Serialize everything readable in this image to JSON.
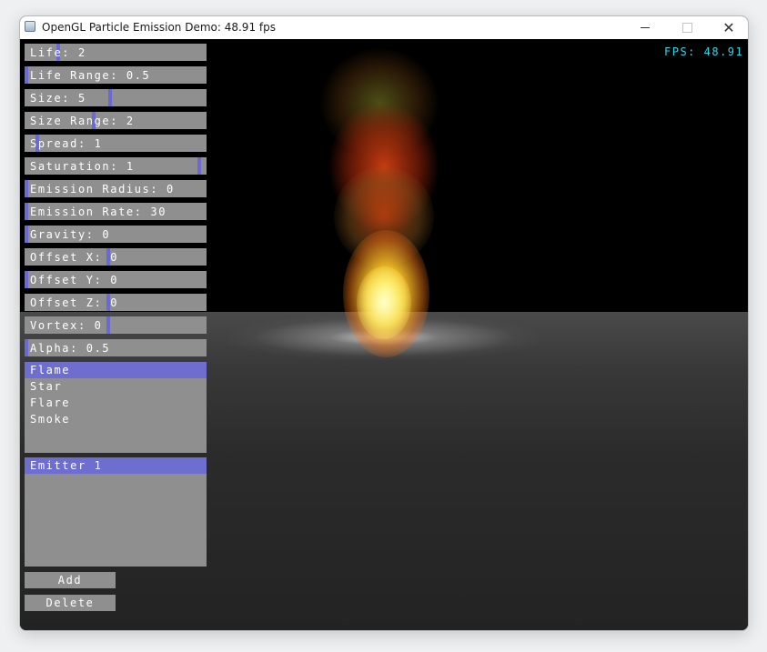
{
  "window": {
    "title": "OpenGL Particle Emission Demo: 48.91 fps"
  },
  "controls": {
    "minimize": "—",
    "maximize": "☐",
    "close": "✕"
  },
  "viewport": {
    "fps": "FPS: 48.91"
  },
  "sliders": [
    {
      "label": "Life: 2",
      "fill": 0.18
    },
    {
      "label": "Life Range: 0.5",
      "fill": 0.0
    },
    {
      "label": "Size: 5",
      "fill": 0.47
    },
    {
      "label": "Size Range: 2",
      "fill": 0.38
    },
    {
      "label": "Spread: 1",
      "fill": 0.06
    },
    {
      "label": "Saturation: 1",
      "fill": 0.97
    },
    {
      "label": "Emission Radius: 0",
      "fill": 0.0
    },
    {
      "label": "Emission Rate: 30",
      "fill": 0.0
    },
    {
      "label": "Gravity: 0",
      "fill": 0.0
    },
    {
      "label": "Offset X: 0",
      "fill": 0.46
    },
    {
      "label": "Offset Y: 0",
      "fill": 0.0
    },
    {
      "label": "Offset Z: 0",
      "fill": 0.46
    },
    {
      "label": "Vortex: 0",
      "fill": 0.46
    },
    {
      "label": "Alpha: 0.5",
      "fill": 0.0
    }
  ],
  "texture_list": {
    "items": [
      "Flame",
      "Star",
      "Flare",
      "Smoke"
    ],
    "selected": "Flame"
  },
  "emitter_list": {
    "items": [
      "Emitter 1"
    ],
    "selected": "Emitter 1"
  },
  "buttons": {
    "add": "Add",
    "delete": "Delete"
  },
  "colors": {
    "accent": "#6e6ed0",
    "panel": "#8f8f8f",
    "fps_text": "#33d6e6"
  }
}
